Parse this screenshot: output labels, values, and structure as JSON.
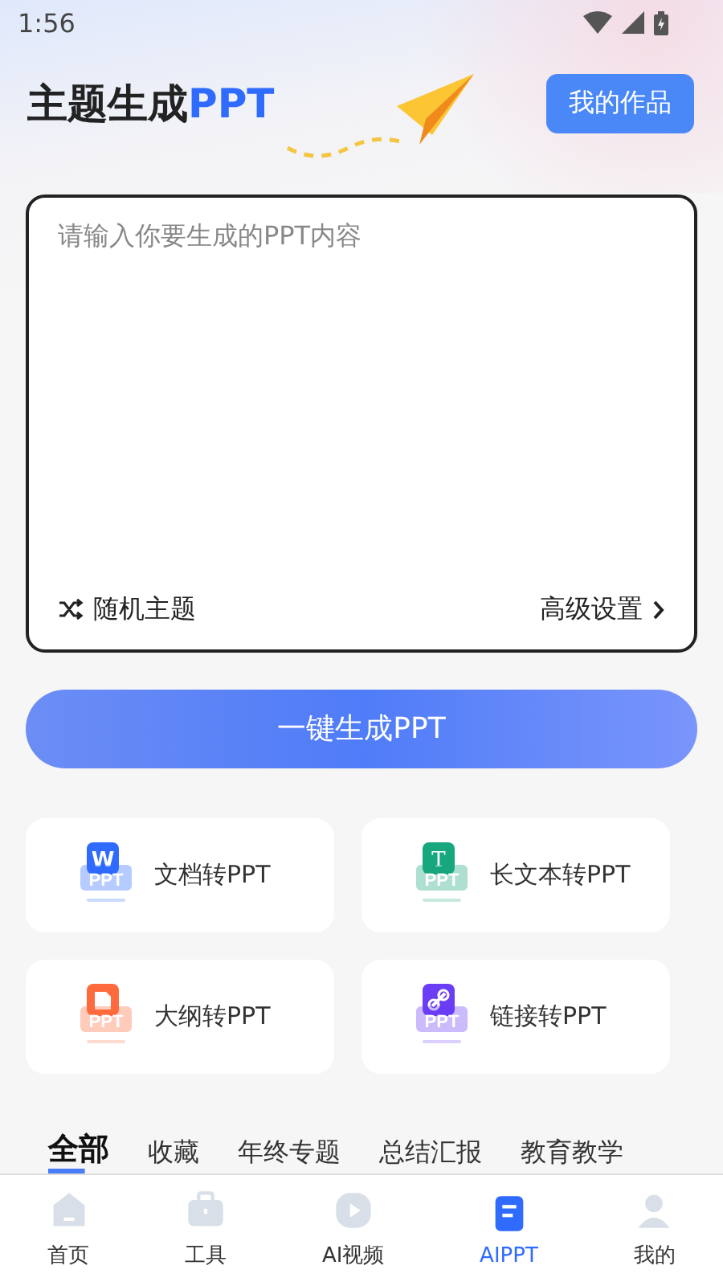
{
  "status_bar": {
    "time": "1:56"
  },
  "header": {
    "title": "主题生成",
    "title_accent": "PPT",
    "my_works_button": "我的作品"
  },
  "prompt": {
    "placeholder": "请输入你要生成的PPT内容",
    "random_topic": "随机主题",
    "advanced_settings": "高级设置"
  },
  "generate_button": "一键生成PPT",
  "tools": [
    {
      "kind": "word",
      "glyph": "W",
      "badge": "PPT",
      "label": "文档转PPT",
      "color": "#2f6bff"
    },
    {
      "kind": "text",
      "glyph": "T",
      "badge": "PPT",
      "label": "长文本转PPT",
      "color": "#17a77f"
    },
    {
      "kind": "outline",
      "badge": "PPT",
      "label": "大纲转PPT",
      "color": "#ff6a3d"
    },
    {
      "kind": "link",
      "badge": "PPT",
      "label": "链接转PPT",
      "color": "#6b3df5"
    }
  ],
  "categories": [
    {
      "label": "全部",
      "selected": true
    },
    {
      "label": "收藏",
      "selected": false
    },
    {
      "label": "年终专题",
      "selected": false
    },
    {
      "label": "总结汇报",
      "selected": false
    },
    {
      "label": "教育教学",
      "selected": false
    }
  ],
  "nav": [
    {
      "kind": "home",
      "label": "首页",
      "selected": false
    },
    {
      "kind": "tools",
      "label": "工具",
      "selected": false
    },
    {
      "kind": "video",
      "label": "AI视频",
      "selected": false
    },
    {
      "kind": "ppt",
      "label": "AIPPT",
      "selected": true
    },
    {
      "kind": "me",
      "label": "我的",
      "selected": false
    }
  ]
}
